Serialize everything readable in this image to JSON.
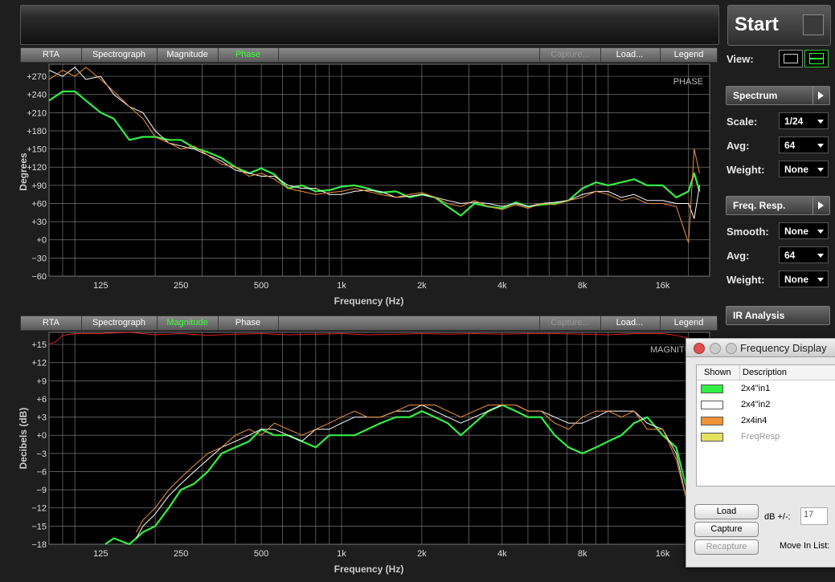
{
  "tabs": {
    "rta": "RTA",
    "spectrograph": "Spectrograph",
    "magnitude": "Magnitude",
    "phase": "Phase",
    "capture": "Capture...",
    "load": "Load...",
    "legend": "Legend"
  },
  "phase_chart": {
    "corner_label": "PHASE",
    "ylabel": "Degrees",
    "xlabel": "Frequency (Hz)",
    "yticks": [
      "+270",
      "+240",
      "+210",
      "+180",
      "+150",
      "+120",
      "+90",
      "+60",
      "+30",
      "+0",
      "−30",
      "−60"
    ],
    "xticks": [
      "125",
      "250",
      "500",
      "1k",
      "2k",
      "4k",
      "8k",
      "16k"
    ]
  },
  "magnitude_chart": {
    "corner_label": "MAGNITUDE",
    "ylabel": "Decibels (dB)",
    "xlabel": "Frequency (Hz)",
    "yticks": [
      "+15",
      "+12",
      "+9",
      "+6",
      "+3",
      "+0",
      "−3",
      "−6",
      "−9",
      "−12",
      "−15",
      "−18"
    ],
    "xticks": [
      "125",
      "250",
      "500",
      "1k",
      "2k",
      "4k",
      "8k",
      "16k"
    ]
  },
  "colors": {
    "green": "#33ee44",
    "white": "#ffffff",
    "orange": "#f0923a",
    "red": "#e02020",
    "active_tab": "#39ff39"
  },
  "chart_data": [
    {
      "type": "line",
      "title": "PHASE",
      "xlabel": "Frequency (Hz)",
      "ylabel": "Degrees",
      "xscale": "log",
      "xlim": [
        80,
        24000
      ],
      "ylim": [
        -60,
        290
      ],
      "grid": true,
      "series": [
        {
          "name": "2x4\"in1",
          "color": "#33ee44",
          "x": [
            80,
            90,
            100,
            110,
            125,
            140,
            160,
            180,
            200,
            225,
            250,
            280,
            315,
            355,
            400,
            450,
            500,
            560,
            630,
            710,
            800,
            900,
            1000,
            1120,
            1250,
            1400,
            1600,
            1800,
            2000,
            2240,
            2500,
            2800,
            3150,
            3550,
            4000,
            4500,
            5000,
            5600,
            6300,
            7100,
            8000,
            9000,
            10000,
            11200,
            12500,
            14000,
            16000,
            18000,
            20000,
            21000,
            22000
          ],
          "y": [
            230,
            245,
            245,
            230,
            210,
            200,
            165,
            170,
            170,
            165,
            165,
            152,
            145,
            135,
            120,
            110,
            118,
            108,
            85,
            90,
            80,
            82,
            88,
            90,
            85,
            78,
            80,
            70,
            75,
            70,
            55,
            40,
            60,
            55,
            52,
            62,
            55,
            58,
            60,
            65,
            85,
            95,
            90,
            95,
            100,
            90,
            90,
            70,
            80,
            110,
            80
          ]
        },
        {
          "name": "2x4\"in2",
          "color": "#ffffff",
          "x": [
            80,
            90,
            100,
            110,
            125,
            140,
            160,
            180,
            200,
            225,
            250,
            280,
            315,
            355,
            400,
            450,
            500,
            560,
            630,
            710,
            800,
            900,
            1000,
            1120,
            1250,
            1400,
            1600,
            1800,
            2000,
            2240,
            2500,
            2800,
            3150,
            3550,
            4000,
            4500,
            5000,
            5600,
            6300,
            7100,
            8000,
            9000,
            10000,
            11200,
            12500,
            14000,
            16000,
            18000,
            20000,
            21000,
            22000
          ],
          "y": [
            280,
            270,
            285,
            265,
            270,
            240,
            220,
            210,
            180,
            160,
            155,
            150,
            140,
            130,
            115,
            110,
            105,
            105,
            90,
            85,
            85,
            75,
            75,
            80,
            82,
            80,
            70,
            72,
            75,
            70,
            65,
            60,
            62,
            60,
            55,
            60,
            55,
            60,
            62,
            65,
            75,
            80,
            80,
            70,
            75,
            65,
            65,
            60,
            60,
            35,
            90
          ]
        },
        {
          "name": "2x4in4",
          "color": "#f0923a",
          "x": [
            80,
            90,
            100,
            110,
            125,
            140,
            160,
            180,
            200,
            225,
            250,
            280,
            315,
            355,
            400,
            450,
            500,
            560,
            630,
            710,
            800,
            900,
            1000,
            1120,
            1250,
            1400,
            1600,
            1800,
            2000,
            2240,
            2500,
            2800,
            3150,
            3550,
            4000,
            4500,
            5000,
            5600,
            6300,
            7100,
            8000,
            9000,
            10000,
            11200,
            12500,
            14000,
            16000,
            18000,
            20000,
            21000,
            22000
          ],
          "y": [
            265,
            280,
            270,
            285,
            265,
            245,
            220,
            200,
            170,
            160,
            150,
            155,
            140,
            125,
            120,
            105,
            110,
            100,
            85,
            80,
            75,
            78,
            80,
            85,
            80,
            75,
            70,
            75,
            78,
            70,
            60,
            55,
            65,
            55,
            50,
            58,
            52,
            60,
            58,
            65,
            70,
            80,
            75,
            65,
            70,
            60,
            60,
            55,
            -5,
            150,
            110
          ]
        }
      ]
    },
    {
      "type": "line",
      "title": "MAGNITUDE",
      "xlabel": "Frequency (Hz)",
      "ylabel": "Decibels (dB)",
      "xscale": "log",
      "xlim": [
        80,
        24000
      ],
      "ylim": [
        -18,
        17
      ],
      "grid": true,
      "series": [
        {
          "name": "2x4\"in1",
          "color": "#33ee44",
          "x": [
            130,
            140,
            160,
            180,
            200,
            225,
            250,
            280,
            315,
            355,
            400,
            450,
            500,
            560,
            630,
            710,
            800,
            900,
            1000,
            1120,
            1250,
            1400,
            1600,
            1800,
            2000,
            2240,
            2500,
            2800,
            3150,
            3550,
            4000,
            4500,
            5000,
            5600,
            6300,
            7100,
            8000,
            9000,
            10000,
            11200,
            12500,
            14000,
            16000,
            18000,
            20000,
            22000
          ],
          "y": [
            -18,
            -17,
            -18,
            -16,
            -15,
            -12,
            -9,
            -8,
            -6,
            -3,
            -2,
            -1,
            1,
            0,
            0,
            -1,
            -2,
            0,
            0,
            0,
            1,
            2,
            3,
            3,
            4,
            3,
            2,
            0,
            2,
            4,
            5,
            4,
            3,
            3,
            0,
            -2,
            -3,
            -2,
            -1,
            0,
            2,
            3,
            0,
            -2,
            -10,
            -17
          ]
        },
        {
          "name": "2x4\"in2",
          "color": "#ffffff",
          "x": [
            170,
            180,
            200,
            225,
            250,
            280,
            315,
            355,
            400,
            450,
            500,
            560,
            630,
            710,
            800,
            900,
            1000,
            1120,
            1250,
            1400,
            1600,
            1800,
            2000,
            2240,
            2500,
            2800,
            3150,
            3550,
            4000,
            4500,
            5000,
            5600,
            6300,
            7100,
            8000,
            9000,
            10000,
            11200,
            12500,
            14000,
            16000,
            18000,
            20000,
            22000
          ],
          "y": [
            -17,
            -15,
            -13,
            -10,
            -8,
            -6,
            -4,
            -2,
            -1,
            0,
            1,
            1,
            0,
            -1,
            1,
            1,
            2,
            3,
            3,
            3,
            4,
            4,
            5,
            4,
            3,
            2,
            3,
            4,
            5,
            5,
            4,
            4,
            3,
            2,
            2,
            3,
            4,
            4,
            4,
            2,
            1,
            -3,
            -12,
            -17
          ]
        },
        {
          "name": "2x4in4",
          "color": "#f0923a",
          "x": [
            170,
            180,
            200,
            225,
            250,
            280,
            315,
            355,
            400,
            450,
            500,
            560,
            630,
            710,
            800,
            900,
            1000,
            1120,
            1250,
            1400,
            1600,
            1800,
            2000,
            2240,
            2500,
            2800,
            3150,
            3550,
            4000,
            4500,
            5000,
            5600,
            6300,
            7100,
            8000,
            9000,
            10000,
            11200,
            12500,
            14000,
            16000,
            18000,
            20000,
            22000
          ],
          "y": [
            -16,
            -14,
            -12,
            -9,
            -7,
            -5,
            -3,
            -2,
            0,
            1,
            0,
            2,
            1,
            0,
            1,
            2,
            3,
            4,
            3,
            3,
            4,
            5,
            5,
            5,
            4,
            3,
            4,
            5,
            5,
            5,
            4,
            4,
            2,
            1,
            3,
            4,
            4,
            3,
            4,
            1,
            1,
            -4,
            -12,
            -16
          ]
        },
        {
          "name": "FreqResp",
          "color": "#e02020",
          "x": [
            80,
            85,
            90,
            100,
            125,
            160,
            200,
            250,
            315,
            400,
            500,
            630,
            800,
            1000,
            1250,
            1600,
            2000,
            2500,
            3150,
            4000,
            5000,
            6300,
            8000,
            10000,
            12500,
            16000,
            18000,
            20000,
            21000,
            22000,
            23000
          ],
          "y": [
            15,
            15.5,
            16.5,
            16.8,
            16.8,
            17,
            16.6,
            16.8,
            16.5,
            16.7,
            16.8,
            16.6,
            16.7,
            16.8,
            16.6,
            16.7,
            16.8,
            16.7,
            16.8,
            16.7,
            16.8,
            16.8,
            16.7,
            16.6,
            16.8,
            16.8,
            16.5,
            16,
            15.5,
            15,
            14
          ]
        }
      ]
    }
  ],
  "sidebar": {
    "start": "Start",
    "view_label": "View:",
    "spectrum_header": "Spectrum",
    "scale_label": "Scale:",
    "scale_value": "1/24",
    "avg_label": "Avg:",
    "avg_value": "64",
    "weight_label": "Weight:",
    "weight_value": "None",
    "freq_resp_header": "Freq. Resp.",
    "smooth_label": "Smooth:",
    "smooth_value": "None",
    "fr_avg_label": "Avg:",
    "fr_avg_value": "64",
    "fr_weight_label": "Weight:",
    "fr_weight_value": "None",
    "ir_header": "IR Analysis"
  },
  "freq_display": {
    "title": "Frequency Display",
    "col_shown": "Shown",
    "col_desc": "Description",
    "rows": [
      {
        "label": "2x4\"in1",
        "color": "#33ee44"
      },
      {
        "label": "2x4\"in2",
        "color": "#ffffff"
      },
      {
        "label": "2x4in4",
        "color": "#f0923a"
      },
      {
        "label": "FreqResp",
        "color": "#e6e060"
      }
    ],
    "load": "Load",
    "capture": "Capture",
    "recapture": "Recapture",
    "db_label": "dB +/-:",
    "db_value": "17",
    "move_label": "Move In List:"
  }
}
